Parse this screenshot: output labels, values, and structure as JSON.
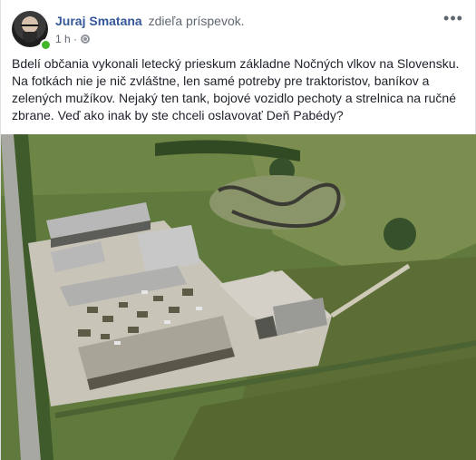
{
  "post": {
    "author": "Juraj Smatana",
    "action": "zdieľa príspevok.",
    "time": "1 h ·",
    "text": "Bdelí občania vykonali letecký prieskum základne Nočných vlkov na Slovensku. Na fotkách nie je nič zvláštne, len samé potreby pre traktoristov, baníkov a zelených mužíkov. Nejaký ten tank, bojové vozidlo pechoty a strelnica na ručné zbrane. Veď ako inak by ste chceli oslavovať Deň Pabédy?",
    "more_label": "•••"
  },
  "icons": {
    "avatar": "avatar-photo",
    "online": "online-status-dot",
    "privacy": "globe-icon",
    "more": "more-options-icon"
  },
  "colors": {
    "author": "#365899",
    "meta": "#616770",
    "online": "#42b72a",
    "field": "#5f7a3c",
    "field_dark": "#3f5a2b",
    "roof": "#b8b8b8",
    "concrete": "#c9c4b8"
  }
}
